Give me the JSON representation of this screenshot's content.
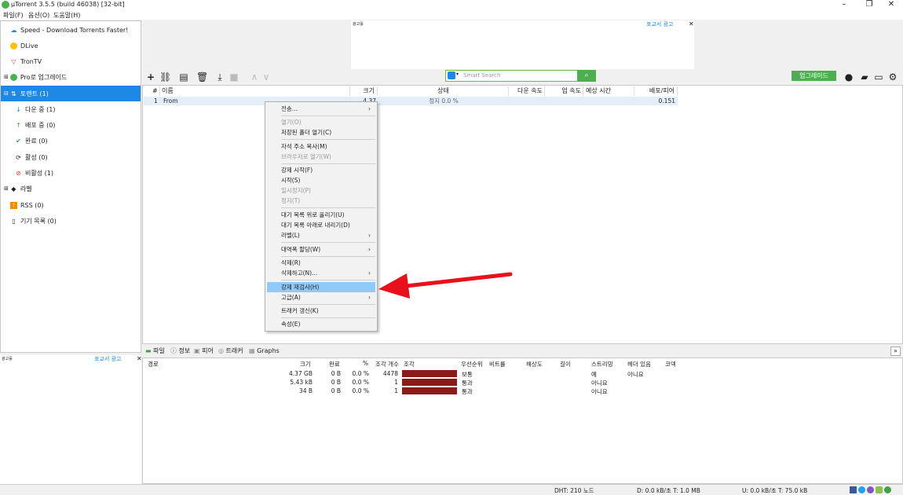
{
  "window": {
    "title": "µTorrent 3.5.5  (build 46038) [32-bit]"
  },
  "menubar": [
    "파일(F)",
    "옵션(O)",
    "도움말(H)"
  ],
  "ads": {
    "top_label": "광고를",
    "top_link": "포교서 광고",
    "side_label": "광고를",
    "side_link": "포교서 광고"
  },
  "sidebar": {
    "items": [
      {
        "label": "Speed - Download Torrents Faster!"
      },
      {
        "label": "DLive"
      },
      {
        "label": "TronTV"
      },
      {
        "label": "Pro로 업그레이드"
      },
      {
        "label": "토렌트 (1)"
      },
      {
        "label": "다운 중 (1)"
      },
      {
        "label": "배포 중 (0)"
      },
      {
        "label": "완료 (0)"
      },
      {
        "label": "활성 (0)"
      },
      {
        "label": "비활성 (1)"
      },
      {
        "label": "라벨"
      },
      {
        "label": "RSS (0)"
      },
      {
        "label": "기기 목록 (0)"
      }
    ]
  },
  "toolbar": {
    "search_placeholder": "Smart Search",
    "upgrade_label": "업그레이드"
  },
  "torrent_list": {
    "headers": [
      "#",
      "이름",
      "크기",
      "상태",
      "다운 속도",
      "업 속도",
      "예상 시간",
      "배포/피어"
    ],
    "rows": [
      {
        "num": "1",
        "name": "From",
        "size": "4.37 GB",
        "status": "정지 0.0 %",
        "ratio": "0.151"
      }
    ]
  },
  "context_menu": {
    "items": [
      {
        "label": "전송..."
      },
      {
        "label": "열기(O)"
      },
      {
        "label": "저장된 폴더 열기(C)"
      },
      {
        "label": "자석 주소 복사(M)"
      },
      {
        "label": "브라우저로 열기(W)"
      },
      {
        "label": "강제 시작(F)"
      },
      {
        "label": "시작(S)"
      },
      {
        "label": "일시정지(P)"
      },
      {
        "label": "정지(T)"
      },
      {
        "label": "대기 목록 위로 올리기(U)"
      },
      {
        "label": "대기 목록 아래로 내리기(D)"
      },
      {
        "label": "라벨(L)"
      },
      {
        "label": "대역폭 할당(W)"
      },
      {
        "label": "삭제(R)"
      },
      {
        "label": "삭제하고(N)..."
      },
      {
        "label": "강제 재검사(H)"
      },
      {
        "label": "고급(A)"
      },
      {
        "label": "트래커 갱신(K)"
      },
      {
        "label": "속성(E)"
      }
    ]
  },
  "detail_tabs": [
    "파일",
    "정보",
    "피어",
    "트래커",
    "Graphs"
  ],
  "files": {
    "headers": [
      "경로",
      "크기",
      "완료",
      "%",
      "조각 개수",
      "조각",
      "우선순위",
      "비트률",
      "해상도",
      "길이",
      "스트리밍",
      "헤더 있음",
      "코덱"
    ],
    "rows": [
      {
        "size": "4.37 GB",
        "done": "0 B",
        "pct": "0.0 %",
        "pieces": "4478",
        "priority": "보통",
        "streaming": "예",
        "header": "아니요"
      },
      {
        "size": "5.43 kB",
        "done": "0 B",
        "pct": "0.0 %",
        "pieces": "1",
        "priority": "통과",
        "streaming": "아니요",
        "header": ""
      },
      {
        "size": "34 B",
        "done": "0 B",
        "pct": "0.0 %",
        "pieces": "1",
        "priority": "통과",
        "streaming": "아니요",
        "header": ""
      }
    ]
  },
  "statusbar": {
    "dht": "DHT: 210 노드",
    "down": "D: 0.0 kB/초 T: 1.0 MB",
    "up": "U: 0.0 kB/초 T: 75.0 kB"
  },
  "colors": {
    "accent": "#1e88e5",
    "green": "#4caf50",
    "highlight": "#90caf9",
    "arrow": "#e8101a",
    "progress": "#8b1a1a"
  }
}
